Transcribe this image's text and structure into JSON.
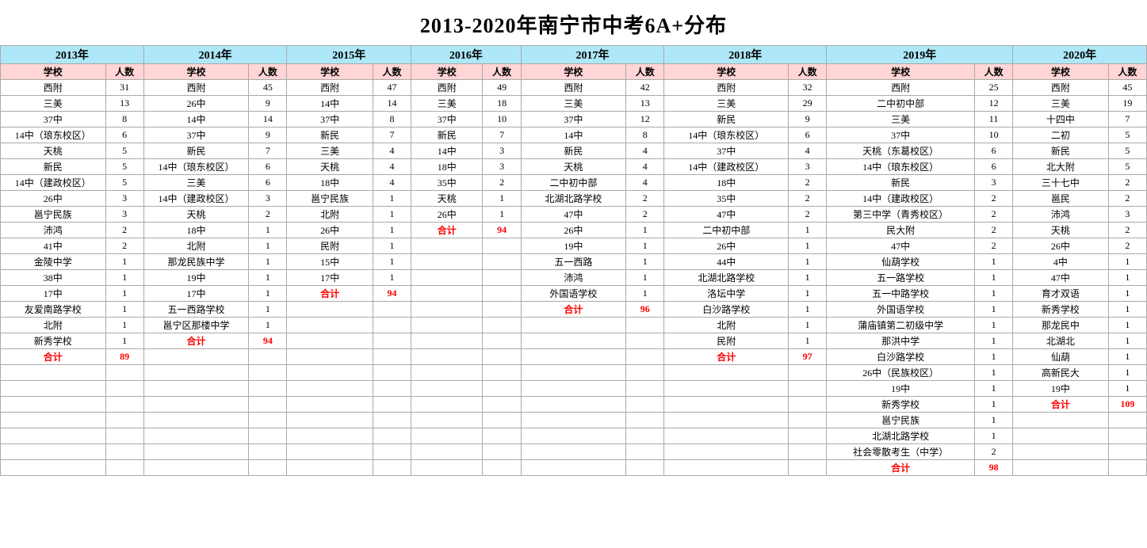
{
  "title": "2013-2020年南宁市中考6A+分布",
  "years": [
    "2013年",
    "2014年",
    "2015年",
    "2016年",
    "2017年",
    "2018年",
    "2019年",
    "2020年"
  ],
  "colHeaders": [
    "学校",
    "人数"
  ],
  "data": {
    "y2013": [
      {
        "school": "西附",
        "num": "31"
      },
      {
        "school": "三美",
        "num": "13"
      },
      {
        "school": "37中",
        "num": "8"
      },
      {
        "school": "14中（琅东校区）",
        "num": "6"
      },
      {
        "school": "天桃",
        "num": "5"
      },
      {
        "school": "新民",
        "num": "5"
      },
      {
        "school": "14中（建政校区）",
        "num": "5"
      },
      {
        "school": "26中",
        "num": "3"
      },
      {
        "school": "邕宁民族",
        "num": "3"
      },
      {
        "school": "沛鸿",
        "num": "2"
      },
      {
        "school": "41中",
        "num": "2"
      },
      {
        "school": "金陵中学",
        "num": "1"
      },
      {
        "school": "38中",
        "num": "1"
      },
      {
        "school": "17中",
        "num": "1"
      },
      {
        "school": "友爱南路学校",
        "num": "1"
      },
      {
        "school": "北附",
        "num": "1"
      },
      {
        "school": "新秀学校",
        "num": "1"
      },
      {
        "school": "合计",
        "num": "89",
        "total": true
      }
    ],
    "y2014": [
      {
        "school": "西附",
        "num": "45"
      },
      {
        "school": "26中",
        "num": "9"
      },
      {
        "school": "14中",
        "num": "14"
      },
      {
        "school": "37中",
        "num": "9"
      },
      {
        "school": "新民",
        "num": "7"
      },
      {
        "school": "14中（琅东校区）",
        "num": "6"
      },
      {
        "school": "三美",
        "num": "6"
      },
      {
        "school": "14中（建政校区）",
        "num": "3"
      },
      {
        "school": "天桃",
        "num": "2"
      },
      {
        "school": "18中",
        "num": "1"
      },
      {
        "school": "北附",
        "num": "1"
      },
      {
        "school": "那龙民族中学",
        "num": "1"
      },
      {
        "school": "19中",
        "num": "1"
      },
      {
        "school": "17中",
        "num": "1"
      },
      {
        "school": "五一西路学校",
        "num": "1"
      },
      {
        "school": "邕宁区那楼中学",
        "num": "1"
      },
      {
        "school": "合计",
        "num": "94",
        "total": true
      }
    ],
    "y2015": [
      {
        "school": "西附",
        "num": "47"
      },
      {
        "school": "14中",
        "num": "14"
      },
      {
        "school": "37中",
        "num": "8"
      },
      {
        "school": "新民",
        "num": "7"
      },
      {
        "school": "三美",
        "num": "4"
      },
      {
        "school": "天桃",
        "num": "4"
      },
      {
        "school": "18中",
        "num": "4"
      },
      {
        "school": "邕宁民族",
        "num": "1"
      },
      {
        "school": "北附",
        "num": "1"
      },
      {
        "school": "26中",
        "num": "1"
      },
      {
        "school": "民附",
        "num": "1"
      },
      {
        "school": "15中",
        "num": "1"
      },
      {
        "school": "17中",
        "num": "1"
      },
      {
        "school": "合计",
        "num": "94",
        "total": true
      }
    ],
    "y2016": [
      {
        "school": "西附",
        "num": "49"
      },
      {
        "school": "三美",
        "num": "18"
      },
      {
        "school": "37中",
        "num": "10"
      },
      {
        "school": "新民",
        "num": "7"
      },
      {
        "school": "14中",
        "num": "3"
      },
      {
        "school": "18中",
        "num": "3"
      },
      {
        "school": "35中",
        "num": "2"
      },
      {
        "school": "天桃",
        "num": "1"
      },
      {
        "school": "26中",
        "num": "1"
      },
      {
        "school": "合计",
        "num": "94",
        "total": true
      }
    ],
    "y2017": [
      {
        "school": "西附",
        "num": "42"
      },
      {
        "school": "三美",
        "num": "13"
      },
      {
        "school": "37中",
        "num": "12"
      },
      {
        "school": "14中",
        "num": "8"
      },
      {
        "school": "新民",
        "num": "4"
      },
      {
        "school": "天桃",
        "num": "4"
      },
      {
        "school": "二中初中部",
        "num": "4"
      },
      {
        "school": "北湖北路学校",
        "num": "2"
      },
      {
        "school": "47中",
        "num": "2"
      },
      {
        "school": "26中",
        "num": "1"
      },
      {
        "school": "19中",
        "num": "1"
      },
      {
        "school": "五一西路",
        "num": "1"
      },
      {
        "school": "沛鸿",
        "num": "1"
      },
      {
        "school": "外国语学校",
        "num": "1"
      },
      {
        "school": "合计",
        "num": "96",
        "total": true
      }
    ],
    "y2018": [
      {
        "school": "西附",
        "num": "32"
      },
      {
        "school": "三美",
        "num": "29"
      },
      {
        "school": "新民",
        "num": "9"
      },
      {
        "school": "14中（琅东校区）",
        "num": "6"
      },
      {
        "school": "37中",
        "num": "4"
      },
      {
        "school": "14中（建政校区）",
        "num": "3"
      },
      {
        "school": "18中",
        "num": "2"
      },
      {
        "school": "35中",
        "num": "2"
      },
      {
        "school": "47中",
        "num": "2"
      },
      {
        "school": "二中初中部",
        "num": "1"
      },
      {
        "school": "26中",
        "num": "1"
      },
      {
        "school": "44中",
        "num": "1"
      },
      {
        "school": "北湖北路学校",
        "num": "1"
      },
      {
        "school": "洛坛中学",
        "num": "1"
      },
      {
        "school": "白沙路学校",
        "num": "1"
      },
      {
        "school": "北附",
        "num": "1"
      },
      {
        "school": "民附",
        "num": "1"
      },
      {
        "school": "合计",
        "num": "97",
        "total": true
      }
    ],
    "y2019": [
      {
        "school": "西附",
        "num": "25"
      },
      {
        "school": "二中初中部",
        "num": "12"
      },
      {
        "school": "三美",
        "num": "11"
      },
      {
        "school": "37中",
        "num": "10"
      },
      {
        "school": "天桃（东葛校区）",
        "num": "6"
      },
      {
        "school": "14中（琅东校区）",
        "num": "6"
      },
      {
        "school": "新民",
        "num": "3"
      },
      {
        "school": "14中（建政校区）",
        "num": "2"
      },
      {
        "school": "第三中学（青秀校区）",
        "num": "2"
      },
      {
        "school": "民大附",
        "num": "2"
      },
      {
        "school": "47中",
        "num": "2"
      },
      {
        "school": "仙葫学校",
        "num": "1"
      },
      {
        "school": "五一路学校",
        "num": "1"
      },
      {
        "school": "五一中路学校",
        "num": "1"
      },
      {
        "school": "外国语学校",
        "num": "1"
      },
      {
        "school": "蒲庙镇第二初级中学",
        "num": "1"
      },
      {
        "school": "那洪中学",
        "num": "1"
      },
      {
        "school": "白沙路学校",
        "num": "1"
      },
      {
        "school": "26中（民族校区）",
        "num": "1"
      },
      {
        "school": "19中",
        "num": "1"
      },
      {
        "school": "新秀学校",
        "num": "1"
      },
      {
        "school": "邕宁民族",
        "num": "1"
      },
      {
        "school": "北湖北路学校",
        "num": "1"
      },
      {
        "school": "社会零散考生（中学）",
        "num": "2"
      },
      {
        "school": "合计",
        "num": "98",
        "total": true
      }
    ],
    "y2020": [
      {
        "school": "西附",
        "num": "45"
      },
      {
        "school": "三美",
        "num": "19"
      },
      {
        "school": "十四中",
        "num": "7"
      },
      {
        "school": "二初",
        "num": "5"
      },
      {
        "school": "新民",
        "num": "5"
      },
      {
        "school": "北大附",
        "num": "5"
      },
      {
        "school": "三十七中",
        "num": "2"
      },
      {
        "school": "邕民",
        "num": "2"
      },
      {
        "school": "沛鸿",
        "num": "3"
      },
      {
        "school": "天桃",
        "num": "2"
      },
      {
        "school": "26中",
        "num": "2"
      },
      {
        "school": "4中",
        "num": "1"
      },
      {
        "school": "47中",
        "num": "1"
      },
      {
        "school": "育才双语",
        "num": "1"
      },
      {
        "school": "新秀学校",
        "num": "1"
      },
      {
        "school": "那龙民中",
        "num": "1"
      },
      {
        "school": "北湖北",
        "num": "1"
      },
      {
        "school": "仙葫",
        "num": "1"
      },
      {
        "school": "高新民大",
        "num": "1"
      },
      {
        "school": "19中",
        "num": "1"
      },
      {
        "school": "合计",
        "num": "109",
        "total": true
      }
    ]
  }
}
